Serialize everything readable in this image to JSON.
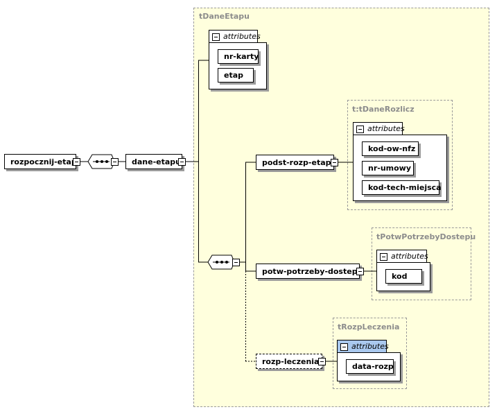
{
  "types": {
    "tDaneEtapu": "tDaneEtapu",
    "tDaneRozlicz": "t:tDaneRozlicz",
    "tPotwPotrzebyDostepu": "tPotwPotrzebyDostepu",
    "tRozpLeczenia": "tRozpLeczenia"
  },
  "attributes_label": "attributes",
  "elements": {
    "root": "rozpocznij-etap",
    "dane_etapu": "dane-etapu",
    "podst_rozp_etapu": "podst-rozp-etapu",
    "potw_potrzeby_dostepu": "potw-potrzeby-dostepu",
    "rozp_leczenia": "rozp-leczenia"
  },
  "attr_lists": {
    "dane_etapu": [
      "nr-karty",
      "etap"
    ],
    "podst_rozp_etapu": [
      "kod-ow-nfz",
      "nr-umowy",
      "kod-tech-miejsca"
    ],
    "potw_potrzeby_dostepu": [
      "kod"
    ],
    "rozp_leczenia": [
      "data-rozp"
    ]
  },
  "colors": {
    "type_background": "#ffffdd",
    "type_border": "#999999",
    "highlight_tab": "#a9c8ee",
    "shadow": "#9b9b9b"
  }
}
